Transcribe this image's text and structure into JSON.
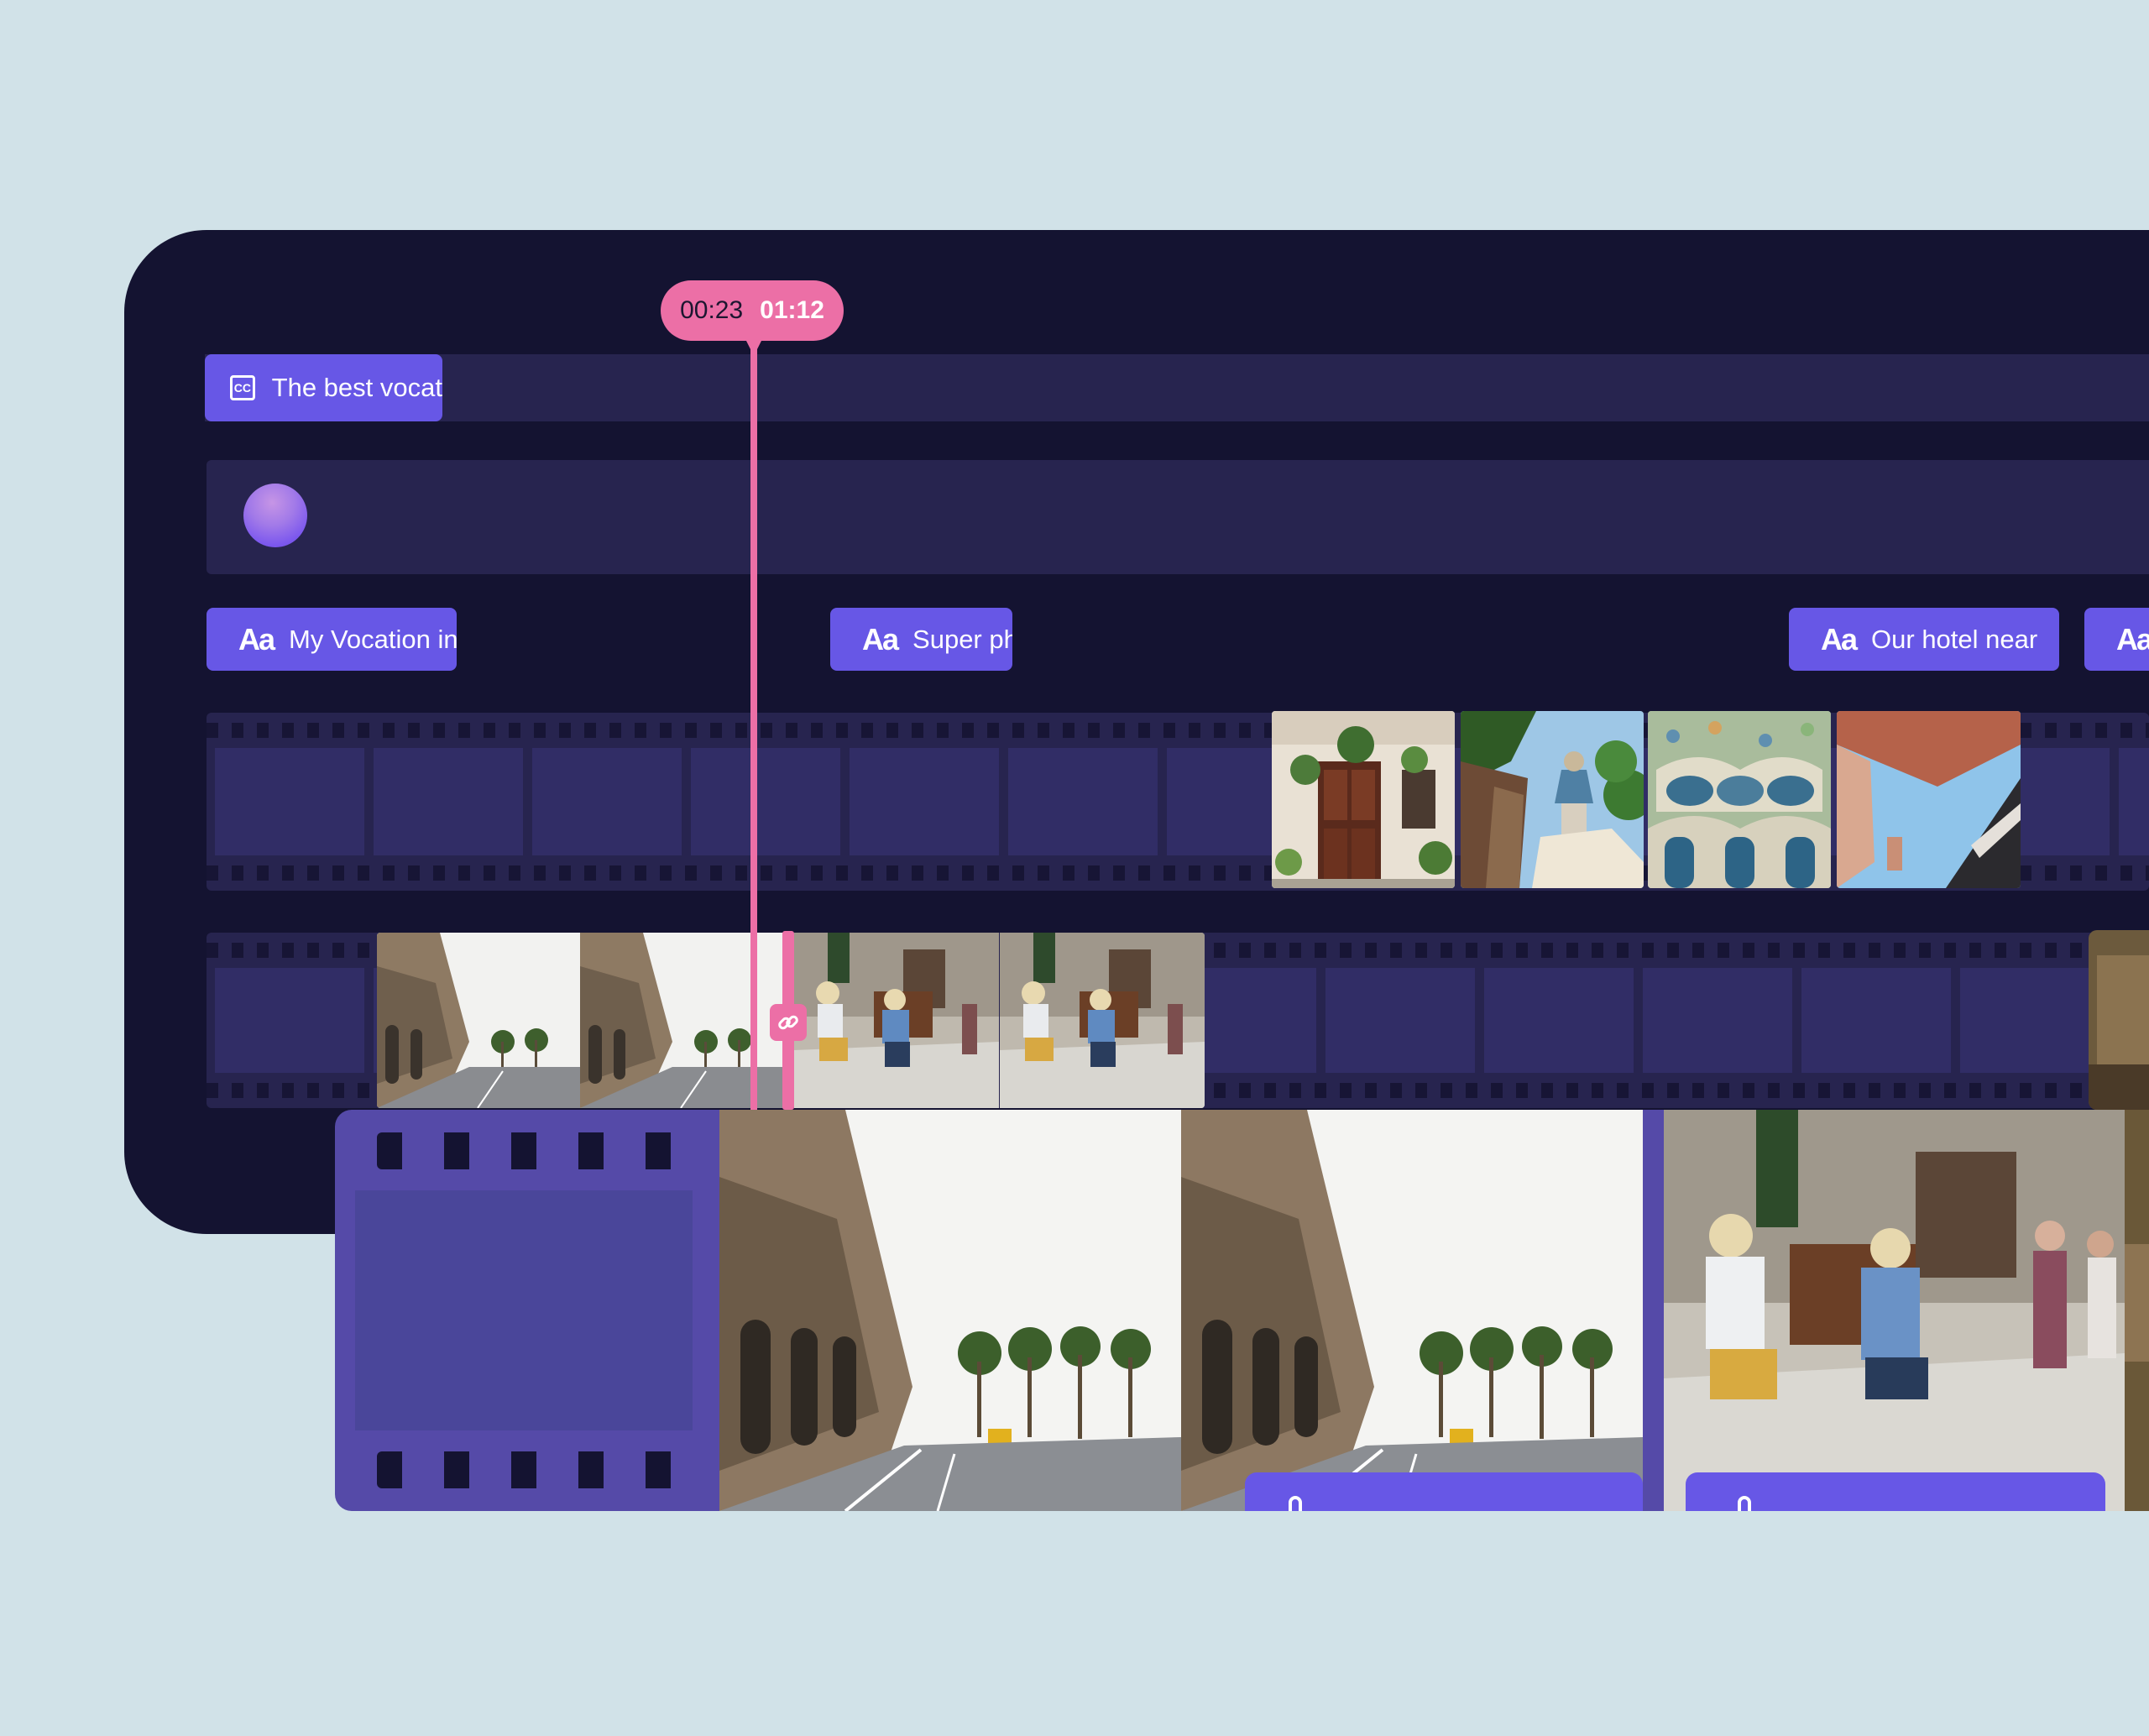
{
  "playhead": {
    "current_time": "00:23",
    "total_time": "01:12"
  },
  "tracks": {
    "caption": {
      "icon": "closed-captions-icon",
      "text": "The best vocat"
    },
    "audio": {
      "icon": "audio-orb-icon"
    },
    "text_clips": [
      {
        "icon": "text-icon",
        "icon_glyph": "Aa",
        "text": "My Vocation in"
      },
      {
        "icon": "text-icon",
        "icon_glyph": "Aa",
        "text": "Super ph"
      },
      {
        "icon": "text-icon",
        "icon_glyph": "Aa",
        "text": "Our hotel near"
      },
      {
        "icon": "text-icon",
        "icon_glyph": "Aa",
        "text": ""
      }
    ],
    "photo_clips": [
      "house-facade-photo",
      "park-guell-photo",
      "casa-batllo-photo",
      "building-sky-photo"
    ],
    "video_clips": [
      "street-avenue-clip",
      "street-musicians-clip"
    ],
    "link_icon": "link-icon"
  },
  "zoom_preview": {
    "icon": "film-icon",
    "clips": [
      "street-avenue-clip",
      "street-musicians-clip"
    ]
  },
  "colors": {
    "background": "#d1e2e8",
    "panel": "#141331",
    "lane": "#27244f",
    "clip_accent": "#6757e6",
    "playhead": "#ec6fa6",
    "film_preview": "#554aa8"
  }
}
